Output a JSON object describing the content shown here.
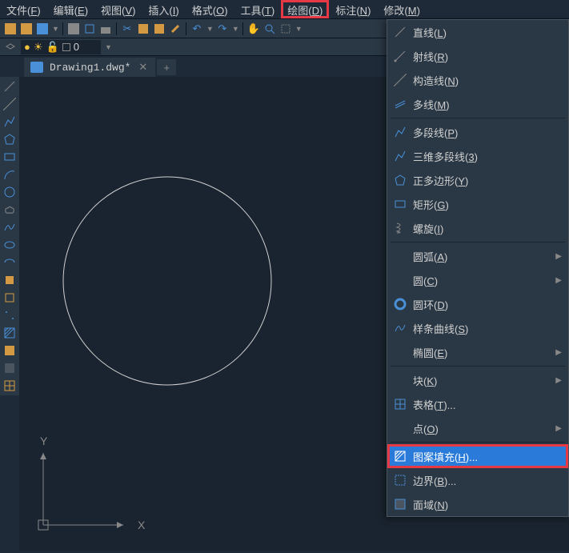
{
  "menubar": [
    {
      "label": "文件",
      "key": "F"
    },
    {
      "label": "编辑",
      "key": "E"
    },
    {
      "label": "视图",
      "key": "V"
    },
    {
      "label": "插入",
      "key": "I"
    },
    {
      "label": "格式",
      "key": "O"
    },
    {
      "label": "工具",
      "key": "T"
    },
    {
      "label": "绘图",
      "key": "D",
      "highlighted": true
    },
    {
      "label": "标注",
      "key": "N"
    },
    {
      "label": "修改",
      "key": "M"
    }
  ],
  "tab": {
    "filename": "Drawing1.dwg*"
  },
  "layer": {
    "name": "0"
  },
  "dropdown": [
    {
      "label": "直线",
      "key": "L",
      "icon": "line"
    },
    {
      "label": "射线",
      "key": "R",
      "icon": "ray"
    },
    {
      "label": "构造线",
      "key": "N",
      "icon": "xline"
    },
    {
      "label": "多线",
      "key": "M",
      "icon": "mline"
    },
    {
      "sep": true
    },
    {
      "label": "多段线",
      "key": "P",
      "icon": "pline"
    },
    {
      "label": "三维多段线",
      "key": "3",
      "icon": "3dpline"
    },
    {
      "label": "正多边形",
      "key": "Y",
      "icon": "polygon"
    },
    {
      "label": "矩形",
      "key": "G",
      "icon": "rect"
    },
    {
      "label": "螺旋",
      "key": "I",
      "icon": "helix"
    },
    {
      "sep": true
    },
    {
      "label": "圆弧",
      "key": "A",
      "icon": "arc",
      "submenu": true
    },
    {
      "label": "圆",
      "key": "C",
      "icon": "circle",
      "submenu": true
    },
    {
      "label": "圆环",
      "key": "D",
      "icon": "donut"
    },
    {
      "label": "样条曲线",
      "key": "S",
      "icon": "spline"
    },
    {
      "label": "椭圆",
      "key": "E",
      "icon": "ellipse",
      "submenu": true
    },
    {
      "sep": true
    },
    {
      "label": "块",
      "key": "K",
      "submenu": true
    },
    {
      "label": "表格",
      "key": "T",
      "icon": "table",
      "suffix": "..."
    },
    {
      "label": "点",
      "key": "O",
      "submenu": true
    },
    {
      "sep": true
    },
    {
      "label": "图案填充",
      "key": "H",
      "icon": "hatch",
      "suffix": "...",
      "selected": true
    },
    {
      "label": "边界",
      "key": "B",
      "icon": "boundary",
      "suffix": "..."
    },
    {
      "label": "面域",
      "key": "N",
      "icon": "region"
    }
  ],
  "axis": {
    "x": "X",
    "y": "Y"
  }
}
